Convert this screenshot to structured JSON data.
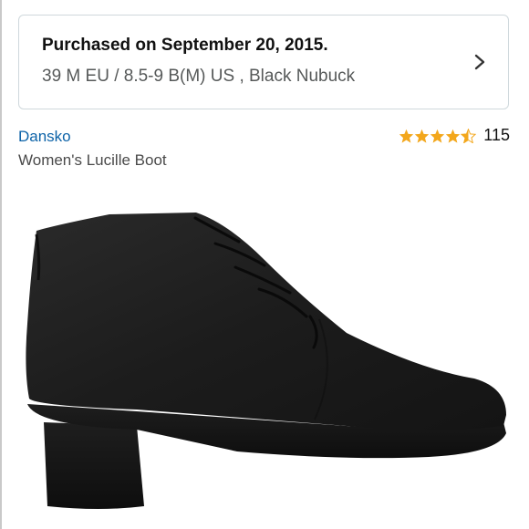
{
  "purchase": {
    "title": "Purchased on September 20, 2015.",
    "details": "39 M EU / 8.5-9 B(M) US , Black Nubuck"
  },
  "product": {
    "brand": "Dansko",
    "name": "Women's Lucille Boot",
    "image_icon": "boot-product-image"
  },
  "rating": {
    "stars": 4.5,
    "max_stars": 5,
    "review_count": "115",
    "star_color": "#f3a71c"
  },
  "colors": {
    "brand_link": "#0d63a8",
    "card_border": "#cfd8dc",
    "detail_text": "#565959"
  }
}
